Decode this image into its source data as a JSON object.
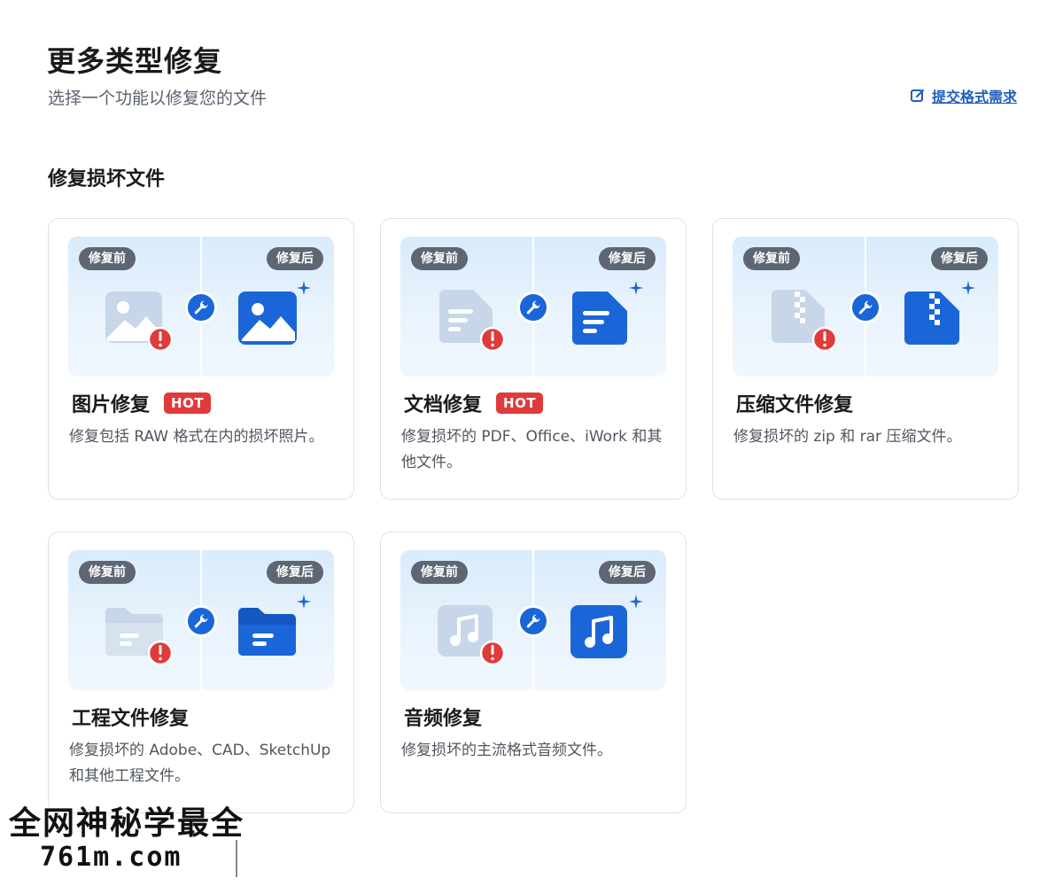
{
  "header": {
    "title": "更多类型修复",
    "subtitle": "选择一个功能以修复您的文件",
    "submit_link": "提交格式需求"
  },
  "section": {
    "title": "修复损坏文件"
  },
  "labels": {
    "before": "修复前",
    "after": "修复后",
    "hot": "HOT"
  },
  "cards": [
    {
      "title": "图片修复",
      "hot": true,
      "desc": "修复包括 RAW 格式在内的损坏照片。",
      "icon": "image-icon"
    },
    {
      "title": "文档修复",
      "hot": true,
      "desc": "修复损坏的 PDF、Office、iWork 和其他文件。",
      "icon": "document-icon"
    },
    {
      "title": "压缩文件修复",
      "hot": false,
      "desc": "修复损坏的 zip 和 rar 压缩文件。",
      "icon": "zip-icon"
    },
    {
      "title": "工程文件修复",
      "hot": false,
      "desc": "修复损坏的 Adobe、CAD、SketchUp 和其他工程文件。",
      "icon": "folder-icon"
    },
    {
      "title": "音频修复",
      "hot": false,
      "desc": "修复损坏的主流格式音频文件。",
      "icon": "music-icon"
    }
  ],
  "colors": {
    "accent": "#1a66d9",
    "hot": "#e03a3a",
    "pill": "#5d6672",
    "broken": "#bdcde0",
    "error": "#e03a3a"
  },
  "watermark": {
    "line1": "全网神秘学最全",
    "line2": "761m.com"
  }
}
